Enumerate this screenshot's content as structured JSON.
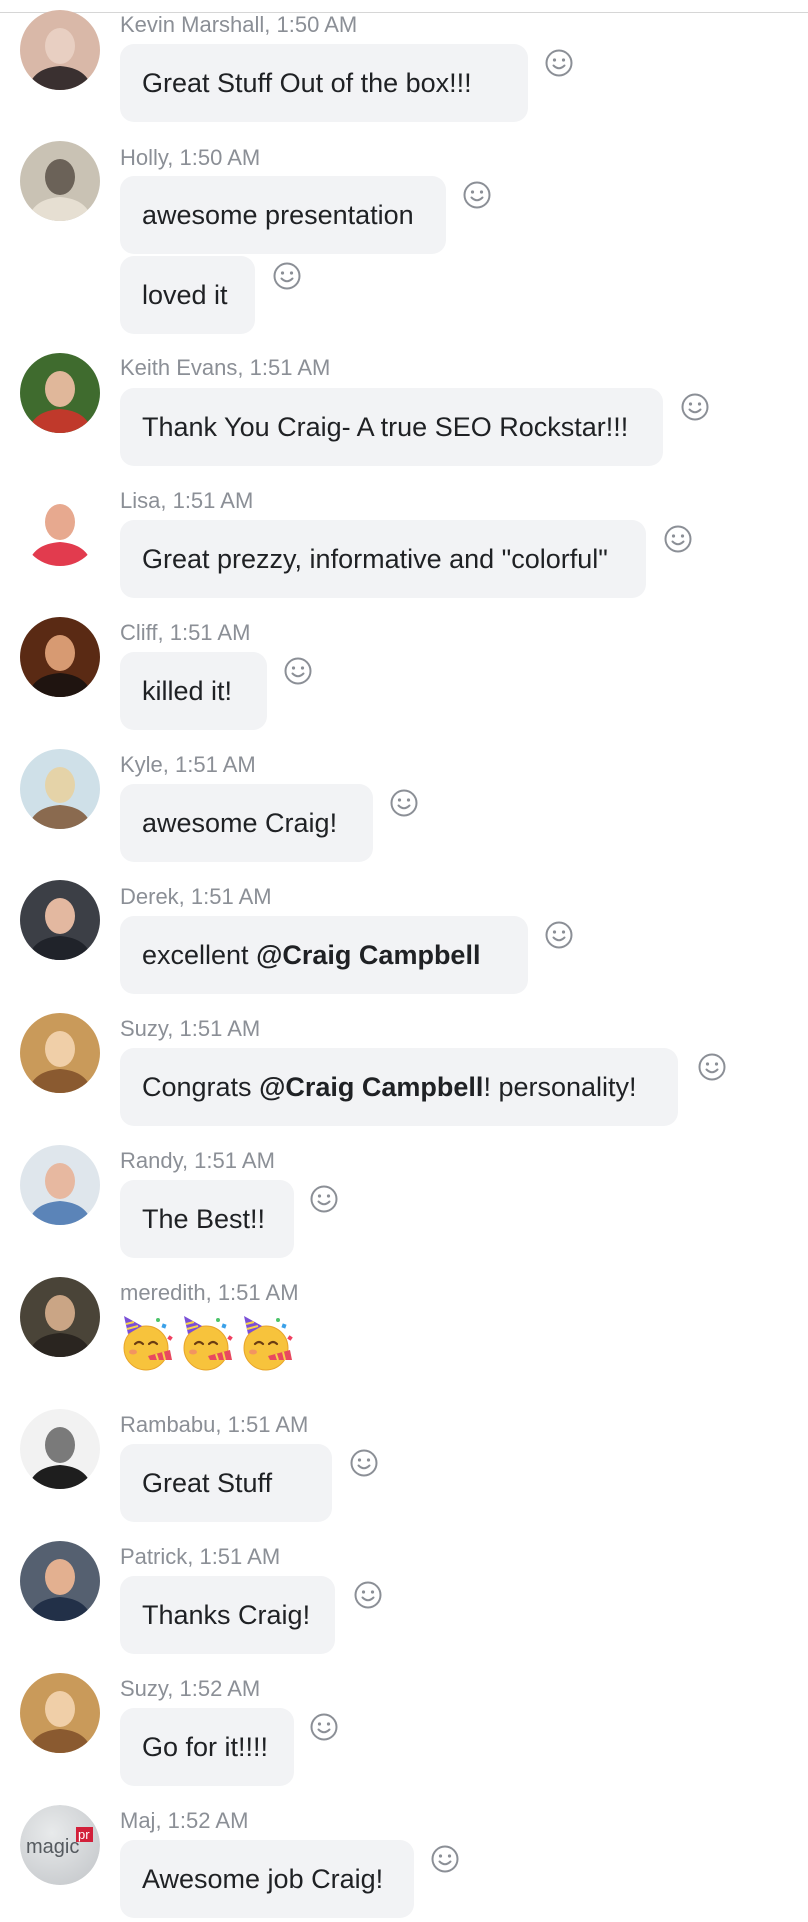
{
  "messages": [
    {
      "sender": "Kevin Marshall",
      "time": "1:50 AM",
      "header": "Kevin Marshall, 1:50 AM",
      "bubbles": [
        {
          "parts": [
            {
              "text": "Great Stuff   Out of the box!!!",
              "bold": false
            }
          ]
        }
      ],
      "avatar_colors": [
        "#d9b8a8",
        "#e8cfc2",
        "#3a3030"
      ]
    },
    {
      "sender": "Holly",
      "time": "1:50 AM",
      "header": "Holly, 1:50 AM",
      "bubbles": [
        {
          "parts": [
            {
              "text": "awesome presentation",
              "bold": false
            }
          ]
        },
        {
          "parts": [
            {
              "text": "loved it",
              "bold": false
            }
          ]
        }
      ],
      "avatar_colors": [
        "#c9c2b4",
        "#6b6258",
        "#e6dfd2"
      ]
    },
    {
      "sender": "Keith Evans",
      "time": "1:51 AM",
      "header": "Keith Evans, 1:51 AM",
      "bubbles": [
        {
          "parts": [
            {
              "text": "Thank You Craig- A true SEO Rockstar!!!",
              "bold": false
            }
          ]
        }
      ],
      "avatar_colors": [
        "#3f6b2e",
        "#e0b79a",
        "#c0392b"
      ]
    },
    {
      "sender": "Lisa",
      "time": "1:51 AM",
      "header": "Lisa, 1:51 AM",
      "bubbles": [
        {
          "parts": [
            {
              "text": "Great prezzy, informative and \"colorful\"",
              "bold": false
            }
          ]
        }
      ],
      "avatar_colors": [
        "#ffffff",
        "#e7a98f",
        "#e23b4e"
      ]
    },
    {
      "sender": "Cliff",
      "time": "1:51 AM",
      "header": "Cliff, 1:51 AM",
      "bubbles": [
        {
          "parts": [
            {
              "text": "killed it!",
              "bold": false
            }
          ]
        }
      ],
      "avatar_colors": [
        "#5a2a14",
        "#d79a72",
        "#1f1410"
      ]
    },
    {
      "sender": "Kyle",
      "time": "1:51 AM",
      "header": "Kyle, 1:51 AM",
      "bubbles": [
        {
          "parts": [
            {
              "text": "awesome Craig!",
              "bold": false
            }
          ]
        }
      ],
      "avatar_colors": [
        "#cfe0e8",
        "#e5d3a8",
        "#8a6a4f"
      ]
    },
    {
      "sender": "Derek",
      "time": "1:51 AM",
      "header": "Derek, 1:51 AM",
      "bubbles": [
        {
          "parts": [
            {
              "text": "excellent ",
              "bold": false
            },
            {
              "text": "@Craig Campbell",
              "bold": true
            }
          ]
        }
      ],
      "avatar_colors": [
        "#3c3f46",
        "#e3b8a0",
        "#20232a"
      ]
    },
    {
      "sender": "Suzy",
      "time": "1:51 AM",
      "header": "Suzy, 1:51 AM",
      "bubbles": [
        {
          "parts": [
            {
              "text": "Congrats ",
              "bold": false
            },
            {
              "text": "@Craig Campbell",
              "bold": true
            },
            {
              "text": "! personality!",
              "bold": false
            }
          ]
        }
      ],
      "avatar_colors": [
        "#c99a5a",
        "#f0cfa8",
        "#8a5a30"
      ]
    },
    {
      "sender": "Randy",
      "time": "1:51 AM",
      "header": "Randy, 1:51 AM",
      "bubbles": [
        {
          "parts": [
            {
              "text": "The Best!!",
              "bold": false
            }
          ]
        }
      ],
      "avatar_colors": [
        "#dfe6ec",
        "#e7b8a0",
        "#5b84b8"
      ]
    },
    {
      "sender": "meredith",
      "time": "1:51 AM",
      "header": "meredith, 1:51 AM",
      "emoji": [
        "partying-face-emoji",
        "partying-face-emoji",
        "partying-face-emoji"
      ],
      "avatar_colors": [
        "#4a4438",
        "#caa585",
        "#2a2520"
      ]
    },
    {
      "sender": "Rambabu",
      "time": "1:51 AM",
      "header": "Rambabu, 1:51 AM",
      "bubbles": [
        {
          "parts": [
            {
              "text": "Great Stuff",
              "bold": false
            }
          ]
        }
      ],
      "avatar_colors": [
        "#f2f2f2",
        "#7a7a7a",
        "#1e1e1e"
      ]
    },
    {
      "sender": "Patrick",
      "time": "1:51 AM",
      "header": "Patrick, 1:51 AM",
      "bubbles": [
        {
          "parts": [
            {
              "text": "Thanks Craig!",
              "bold": false
            }
          ]
        }
      ],
      "avatar_colors": [
        "#556070",
        "#e3b090",
        "#223048"
      ]
    },
    {
      "sender": "Suzy",
      "time": "1:52 AM",
      "header": "Suzy, 1:52 AM",
      "bubbles": [
        {
          "parts": [
            {
              "text": "Go for it!!!!",
              "bold": false
            }
          ]
        }
      ],
      "avatar_colors": [
        "#c99a5a",
        "#f0cfa8",
        "#8a5a30"
      ]
    },
    {
      "sender": "Maj",
      "time": "1:52 AM",
      "header": "Maj, 1:52 AM",
      "bubbles": [
        {
          "parts": [
            {
              "text": "Awesome job Craig!",
              "bold": false
            }
          ]
        }
      ],
      "avatar_logo": "magic",
      "avatar_badge": "pr",
      "avatar_colors": [
        "#c9cccf",
        "#e8eaeb",
        "#d2203a"
      ]
    }
  ],
  "icons": {
    "reaction": "add-reaction-smiley-icon"
  },
  "colors": {
    "bubble_bg": "#f2f3f5",
    "sender_text": "#8b8f96",
    "message_text": "#1f2124",
    "icon_stroke": "#8b8f96"
  }
}
